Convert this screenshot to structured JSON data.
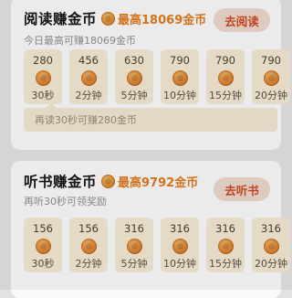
{
  "reading": {
    "title": "阅读赚金币",
    "max_text": "最高18069金币",
    "subtitle": "今日最高可赚18069金币",
    "action": "去阅读",
    "tiles": [
      {
        "amount": "280",
        "duration": "30秒"
      },
      {
        "amount": "456",
        "duration": "2分钟"
      },
      {
        "amount": "630",
        "duration": "5分钟"
      },
      {
        "amount": "790",
        "duration": "10分钟"
      },
      {
        "amount": "790",
        "duration": "15分钟"
      },
      {
        "amount": "790",
        "duration": "20分钟"
      }
    ],
    "tip": "再读30秒可赚280金币"
  },
  "listening": {
    "title": "听书赚金币",
    "max_text": "最高9792金币",
    "subtitle": "再听30秒可领奖励",
    "action": "去听书",
    "tiles": [
      {
        "amount": "156",
        "duration": "30秒"
      },
      {
        "amount": "156",
        "duration": "2分钟"
      },
      {
        "amount": "316",
        "duration": "5分钟"
      },
      {
        "amount": "316",
        "duration": "10分钟"
      },
      {
        "amount": "316",
        "duration": "15分钟"
      },
      {
        "amount": "316",
        "duration": "20分钟"
      }
    ]
  },
  "colors": {
    "accent": "#e27a1f",
    "button_text": "#ce4a26",
    "tile_bg": "#f4e8d2"
  },
  "icons": {
    "coin": "coin-icon"
  }
}
